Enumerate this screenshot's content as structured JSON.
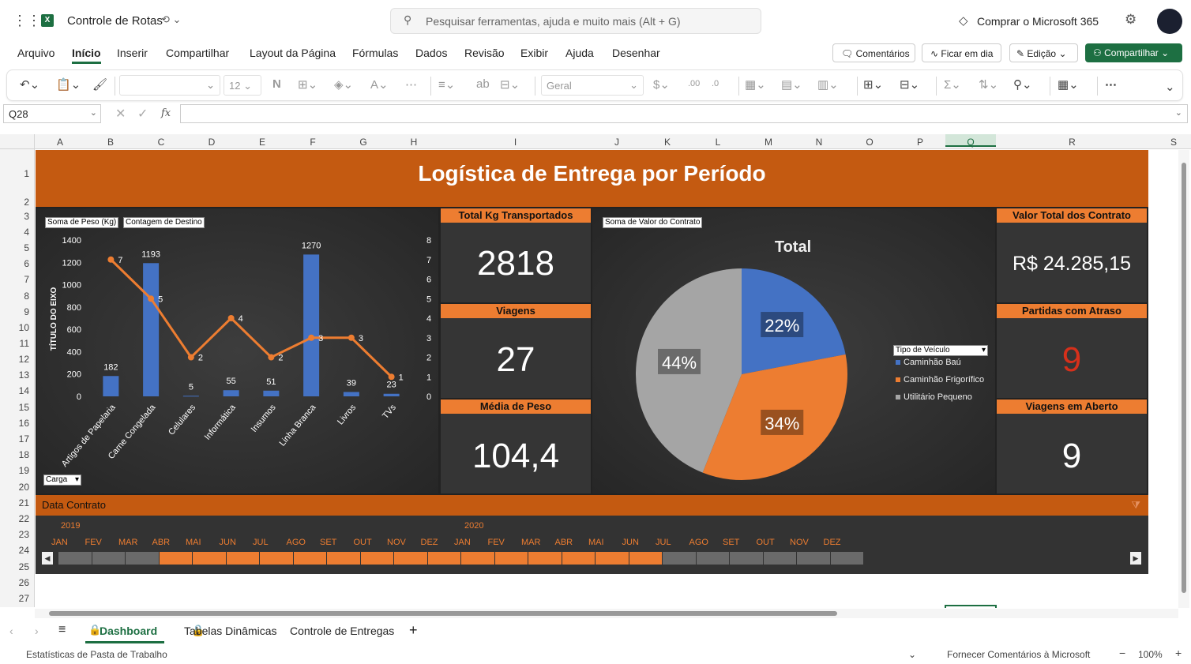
{
  "app": {
    "file_name": "Controle de Rotas",
    "search_placeholder": "Pesquisar ferramentas, ajuda e muito mais (Alt + G)",
    "buy": "Comprar o Microsoft 365"
  },
  "menu": [
    "Arquivo",
    "Início",
    "Inserir",
    "Compartilhar",
    "Layout da Página",
    "Fórmulas",
    "Dados",
    "Revisão",
    "Exibir",
    "Ajuda",
    "Desenhar"
  ],
  "actions": {
    "comments": "Comentários",
    "catchup": "Ficar em dia",
    "editing": "Edição",
    "share": "Compartilhar"
  },
  "ribbon": {
    "font_size": "12",
    "number_format": "Geral"
  },
  "formula": {
    "cell_ref": "Q28",
    "fx": "fx"
  },
  "columns": [
    "A",
    "B",
    "C",
    "D",
    "E",
    "F",
    "G",
    "H",
    "I",
    "J",
    "K",
    "L",
    "M",
    "N",
    "O",
    "P",
    "Q",
    "R",
    "S"
  ],
  "rows": [
    "1",
    "2",
    "3",
    "4",
    "5",
    "6",
    "7",
    "8",
    "9",
    "10",
    "11",
    "12",
    "13",
    "14",
    "15",
    "16",
    "17",
    "18",
    "19",
    "20",
    "21",
    "22",
    "23",
    "24",
    "25",
    "26",
    "27"
  ],
  "dashboard": {
    "title": "Logística de Entrega por Período"
  },
  "combo": {
    "btn_weight": "Soma de Peso (Kg)",
    "btn_count": "Contagem de Destino",
    "btn_filter": "Carga",
    "axis_title": "TÍTULO DO EIXO",
    "left_ticks": [
      "1400",
      "1200",
      "1000",
      "800",
      "600",
      "400",
      "200",
      "0"
    ],
    "right_ticks": [
      "8",
      "7",
      "6",
      "5",
      "4",
      "3",
      "2",
      "1",
      "0"
    ]
  },
  "kpi": {
    "total_kg": {
      "label": "Total Kg Transportados",
      "value": "2818"
    },
    "viagens": {
      "label": "Viagens",
      "value": "27"
    },
    "media": {
      "label": "Média de Peso",
      "value": "104,4"
    },
    "valor_total": {
      "label": "Valor Total dos Contrato",
      "value": "R$ 24.285,15"
    },
    "atraso": {
      "label": "Partidas com Atraso",
      "value": "9"
    },
    "aberto": {
      "label": "Viagens em Aberto",
      "value": "9"
    }
  },
  "pie": {
    "btn": "Soma de Valor do Contrato",
    "title": "Total",
    "legend_btn": "Tipo de Veículo"
  },
  "chart_data": [
    {
      "type": "bar",
      "categories": [
        "Artigos de Papelaria",
        "Carne Congelada",
        "Celulares",
        "Informática",
        "Insumos",
        "Linha Branca",
        "Livros",
        "TVs"
      ],
      "series": [
        {
          "name": "Soma de Peso (Kg)",
          "values": [
            182,
            1193,
            5,
            55,
            51,
            1270,
            39,
            23
          ]
        },
        {
          "name": "Contagem de Destino",
          "values": [
            7,
            5,
            2,
            4,
            2,
            3,
            3,
            1
          ]
        }
      ],
      "ylim": [
        0,
        1400
      ],
      "y2lim": [
        0,
        8
      ],
      "ylabel": "TÍTULO DO EIXO",
      "colors": [
        "#4472c4",
        "#ed7d31"
      ]
    },
    {
      "type": "pie",
      "title": "Total",
      "labels": [
        "Caminhão Baú",
        "Caminhão Frigorífico",
        "Utilitário Pequeno"
      ],
      "values": [
        22,
        34,
        44
      ],
      "display": [
        "22%",
        "34%",
        "44%"
      ],
      "colors": [
        "#4472c4",
        "#ed7d31",
        "#a5a5a5"
      ]
    }
  ],
  "timeline": {
    "title": "Data Contrato",
    "year1": "2019",
    "year2": "2020",
    "months": [
      "JAN",
      "FEV",
      "MAR",
      "ABR",
      "MAI",
      "JUN",
      "JUL",
      "AGO",
      "SET",
      "OUT",
      "NOV",
      "DEZ",
      "JAN",
      "FEV",
      "MAR",
      "ABR",
      "MAI",
      "JUN",
      "JUL",
      "AGO",
      "SET",
      "OUT",
      "NOV",
      "DEZ"
    ],
    "selected_from": "ABR",
    "selected_to": "JUN"
  },
  "sheets": [
    "Dashboard",
    "Tabelas Dinâmicas",
    "Controle de Entregas"
  ],
  "status": {
    "left": "Estatísticas de Pasta de Trabalho",
    "feedback": "Fornecer Comentários à Microsoft",
    "zoom": "100%"
  }
}
